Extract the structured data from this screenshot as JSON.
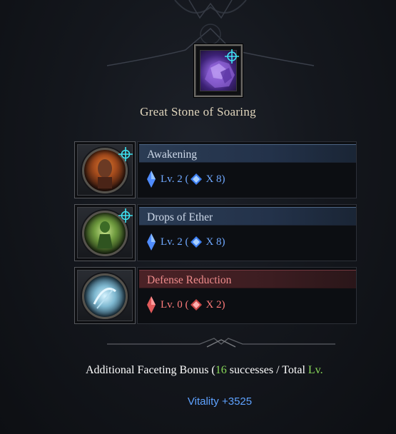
{
  "item": {
    "name": "Great Stone of Soaring",
    "icon": "purple-stone-icon"
  },
  "engravings": [
    {
      "name": "Awakening",
      "level_label": "Lv. 2",
      "multiplier": "X 8",
      "type": "positive",
      "has_badge": true,
      "portrait": "awakening-portrait-icon"
    },
    {
      "name": "Drops of Ether",
      "level_label": "Lv. 2",
      "multiplier": "X 8",
      "type": "positive",
      "has_badge": true,
      "portrait": "drops-of-ether-portrait-icon"
    },
    {
      "name": "Defense Reduction",
      "level_label": "Lv. 0",
      "multiplier": "X 2",
      "type": "negative",
      "has_badge": false,
      "portrait": "defense-reduction-portrait-icon"
    }
  ],
  "bonus": {
    "prefix": "Additional Faceting Bonus (",
    "count": "16",
    "middle": " successes / Total ",
    "suffix": "Lv."
  },
  "stat": {
    "text": "Vitality +3525"
  },
  "colors": {
    "positive": "#6fa8ff",
    "negative": "#ff7b7b",
    "badge": "#3fe1f0",
    "green": "#89d95a"
  }
}
